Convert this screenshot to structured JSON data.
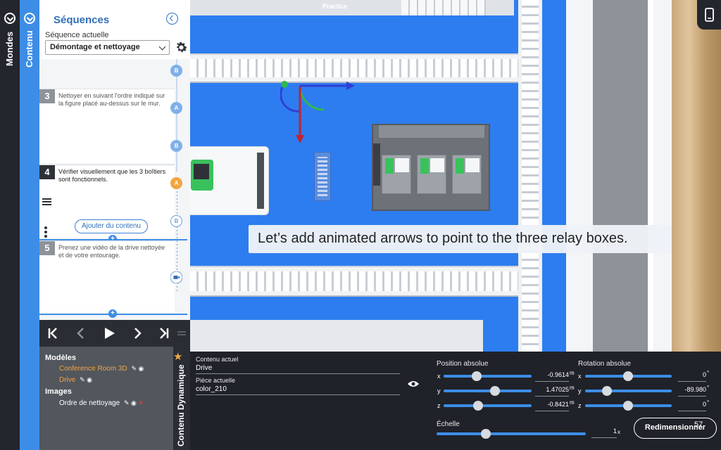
{
  "rails": {
    "mondes": "Mondes",
    "contenu": "Contenu"
  },
  "sequence": {
    "title": "Séquences",
    "current_label": "Séquence actuelle",
    "current_value": "Démontage et nettoyage",
    "steps": [
      {
        "num": "3",
        "text": "Nettoyer en suivant l'ordre indiqué sur la figure placé au-dessus sur le mur."
      },
      {
        "num": "4",
        "text": "Vérifier visuellement que les 3 boîtiers sont fonctionnels."
      },
      {
        "num": "5",
        "text": "Prenez une vidéo de la drive nettoyée et de votre entourage."
      }
    ],
    "nodes": [
      "B",
      "A",
      "B",
      "A",
      "B"
    ],
    "add_content": "Ajouter du contenu",
    "plus": "+"
  },
  "playback": {
    "first": "K",
    "prev": "<",
    "play": "▶",
    "next": ">",
    "last": "K"
  },
  "models": {
    "models_header": "Modèles",
    "model_items": [
      "Conference Room 3D",
      "Drive"
    ],
    "images_header": "Images",
    "image_items": [
      "Ordre de nettoyage"
    ],
    "vertical_title": "Contenu Dynamique"
  },
  "scene": {
    "top_text": "Practice",
    "caption": "Let’s add animated arrows to point to the three relay boxes."
  },
  "props": {
    "current_content_label": "Contenu actuel",
    "current_content_value": "Drive",
    "current_piece_label": "Pièce actuelle",
    "current_piece_value": "color_210",
    "position_label": "Position absolue",
    "rotation_label": "Rotation absolue",
    "scale_label": "Échelle",
    "position": {
      "x": "-0.9614",
      "y": "1.47025",
      "z": "-0.8421",
      "unit": "m"
    },
    "rotation": {
      "x": "0",
      "y": "-89.980",
      "z": "0",
      "unit": "°"
    },
    "scale": {
      "value": "1",
      "unit": "x"
    },
    "axes": [
      "x",
      "y",
      "z"
    ],
    "resize_button": "Redimensionner",
    "fps": "57"
  },
  "colors": {
    "accent": "#3d8de6",
    "orange": "#f2a640",
    "dark": "#1f2229"
  }
}
